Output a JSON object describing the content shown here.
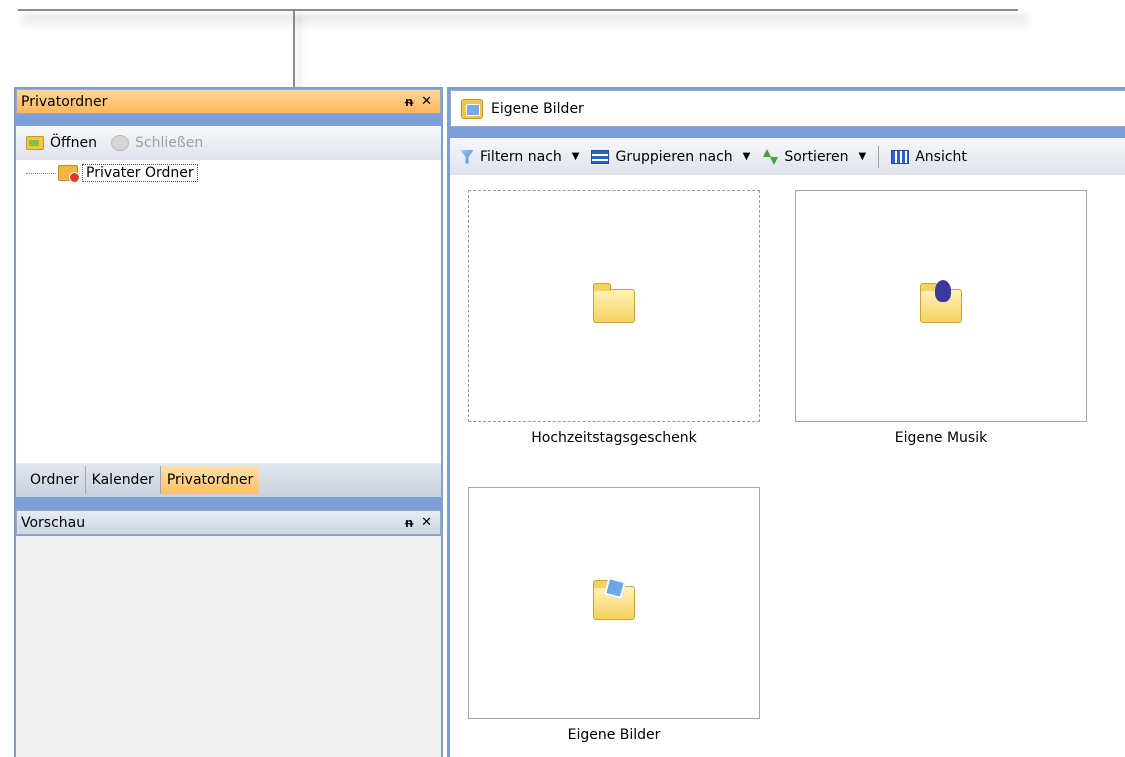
{
  "left_pane": {
    "title": "Privatordner",
    "pin_icon": "pin-icon",
    "close_icon": "close-icon",
    "toolbar": {
      "open_label": "Öffnen",
      "close_label": "Schließen"
    },
    "tree": {
      "item_label": "Privater Ordner"
    },
    "tabs": [
      {
        "label": "Ordner"
      },
      {
        "label": "Kalender"
      },
      {
        "label": "Privatordner"
      }
    ]
  },
  "preview_pane": {
    "title": "Vorschau"
  },
  "right_pane": {
    "title": "Eigene Bilder",
    "toolbar": {
      "filter_label": "Filtern nach",
      "group_label": "Gruppieren nach",
      "sort_label": "Sortieren",
      "view_label": "Ansicht"
    },
    "items": [
      {
        "label": "Hochzeitstagsgeschenk",
        "icon": "folder-icon"
      },
      {
        "label": "Eigene Musik",
        "icon": "music-folder-icon"
      },
      {
        "label": "Eigene Bilder",
        "icon": "pictures-folder-icon"
      }
    ]
  },
  "colors": {
    "active_header": "#ffb65a",
    "frame_blue": "#7b9fd6",
    "selected_tab": "#ffc166"
  }
}
